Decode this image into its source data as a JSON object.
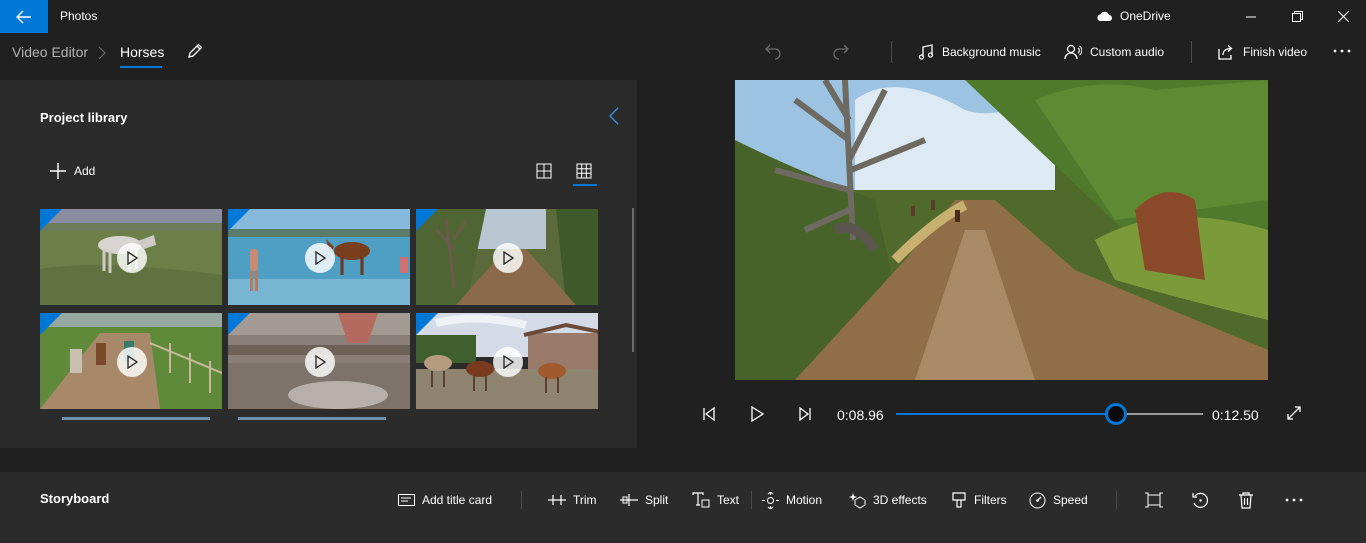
{
  "titlebar": {
    "app_title": "Photos",
    "onedrive_label": "OneDrive",
    "accent": "#0078d7"
  },
  "header": {
    "breadcrumb_root": "Video Editor",
    "project_name": "Horses",
    "background_music": "Background music",
    "custom_audio": "Custom audio",
    "finish_video": "Finish video"
  },
  "library": {
    "title": "Project library",
    "add_label": "Add",
    "thumbnails": [
      {
        "scene": "white horse grazing in field"
      },
      {
        "scene": "horse and children in sea"
      },
      {
        "scene": "horse riders on forest trail"
      },
      {
        "scene": "riders along fenced track"
      },
      {
        "scene": "close-up view from saddle"
      },
      {
        "scene": "horses at farm barn"
      }
    ]
  },
  "player": {
    "current_time": "0:08.96",
    "total_time": "0:12.50",
    "progress": 0.7168
  },
  "storyboard": {
    "title": "Storyboard",
    "add_title_card": "Add title card",
    "trim": "Trim",
    "split": "Split",
    "text": "Text",
    "motion": "Motion",
    "effects_3d": "3D effects",
    "filters": "Filters",
    "speed": "Speed"
  }
}
